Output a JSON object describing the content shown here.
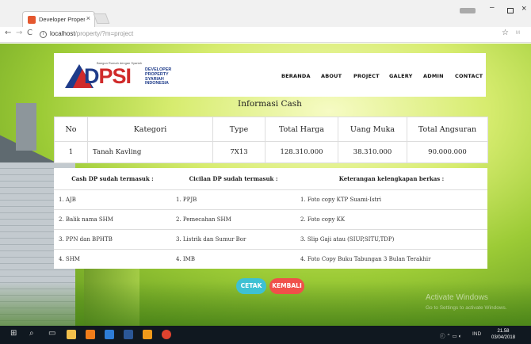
{
  "browser": {
    "tab_title": "Developer Property Syar",
    "tab_close": "×",
    "url_host": "localhost",
    "url_path": "/property/?m=project",
    "nav_back": "←",
    "nav_forward": "→",
    "nav_reload": "C",
    "info_glyph": "i",
    "star_glyph": "☆",
    "ext_label": "M",
    "window_min": "–",
    "window_close": "×"
  },
  "logo": {
    "tagline": "Bangun Rumah dengan Syariah",
    "word_blue": "D",
    "word_red": "PSI",
    "subtitle": "DEVELOPER PROPERTY SYARIAH INDONESIA"
  },
  "nav": {
    "items": [
      "BERANDA",
      "ABOUT",
      "PROJECT",
      "GALERY",
      "ADMIN",
      "CONTACT"
    ]
  },
  "section_title": "Informasi Cash",
  "summary_table": {
    "headers": [
      "No",
      "Kategori",
      "Type",
      "Total Harga",
      "Uang Muka",
      "Total Angsuran"
    ],
    "row": [
      "1",
      "Tanah Kavling",
      "7X13",
      "128.310.000",
      "38.310.000",
      "90.000.000"
    ]
  },
  "notes_table": {
    "headers": [
      "Cash DP sudah termasuk :",
      "Cicilan DP sudah termasuk :",
      "Keterangan kelengkapan berkas :"
    ],
    "rows": [
      [
        "1. AJB",
        "1. PPJB",
        "1. Foto copy KTP Suami-Istri"
      ],
      [
        "2. Balik nama SHM",
        "2. Pemecahan SHM",
        "2. Foto copy KK"
      ],
      [
        "3. PPN dan BPHTB",
        "3. Listrik dan Sumur Bor",
        "3. Slip Gaji atau (SIUP,SITU,TDP)"
      ],
      [
        "4. SHM",
        "4. IMB",
        "4. Foto Copy Buku Tabungan 3 Bulan Terakhir"
      ]
    ]
  },
  "buttons": {
    "print": "CETAK",
    "back": "KEMBALI"
  },
  "watermark": {
    "title": "Activate Windows",
    "subtitle": "Go to Settings to activate Windows."
  },
  "taskbar": {
    "tray_text": "IND",
    "time": "21.58",
    "date": "03/04/2018"
  }
}
